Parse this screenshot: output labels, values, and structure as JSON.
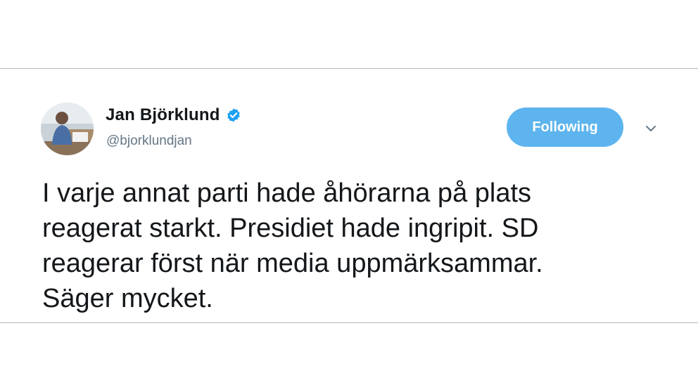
{
  "tweet": {
    "author": {
      "display_name": "Jan Björklund",
      "handle": "@bjorklundjan",
      "verified": true,
      "verified_icon": "verified-badge-icon",
      "avatar": "profile-photo"
    },
    "follow_button_label": "Following",
    "menu_icon": "chevron-down-icon",
    "text_lines": [
      "I varje annat parti hade åhörarna på plats",
      "reagerat starkt. Presidiet hade ingripit. SD",
      "reagerar först när media uppmärksammar.",
      "Säger mycket."
    ]
  },
  "colors": {
    "accent": "#5eb4ee",
    "text": "#14171a",
    "muted": "#657786",
    "verified": "#1da1f2"
  }
}
